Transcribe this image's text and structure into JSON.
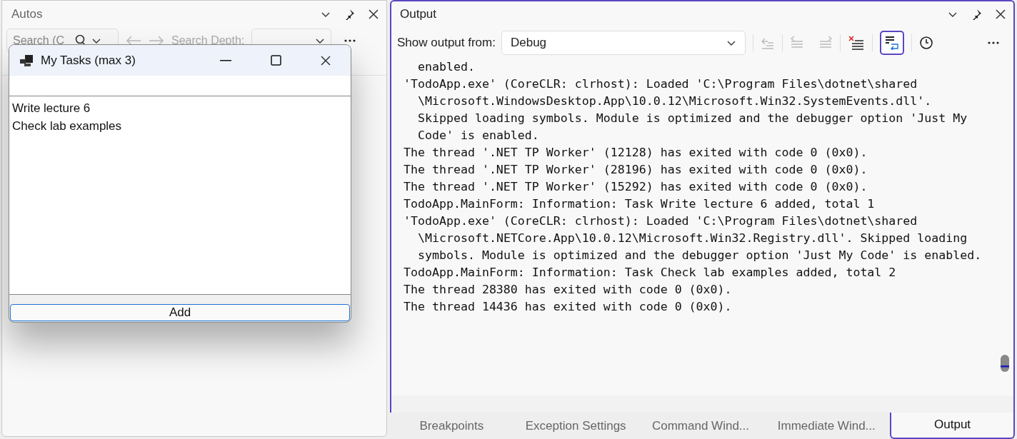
{
  "autos": {
    "title": "Autos",
    "search": {
      "placeholder": "Search (C"
    },
    "depth_label": "Search Depth:"
  },
  "dialog": {
    "title": "My Tasks (max 3)",
    "tasks": [
      "Write lecture 6",
      "Check lab examples"
    ],
    "add_button": "Add"
  },
  "output": {
    "title": "Output",
    "source_label": "Show output from:",
    "source": "Debug",
    "word_wrap": {
      "on": true
    },
    "lines": [
      {
        "text": "enabled.",
        "indent": true
      },
      {
        "text": "'TodoApp.exe' (CoreCLR: clrhost): Loaded 'C:\\Program Files\\dotnet\\shared",
        "indent": false
      },
      {
        "text": "\\Microsoft.WindowsDesktop.App\\10.0.12\\Microsoft.Win32.SystemEvents.dll'.",
        "indent": true
      },
      {
        "text": "Skipped loading symbols. Module is optimized and the debugger option 'Just My",
        "indent": true
      },
      {
        "text": "Code' is enabled.",
        "indent": true
      },
      {
        "text": "The thread '.NET TP Worker' (12128) has exited with code 0 (0x0).",
        "indent": false
      },
      {
        "text": "The thread '.NET TP Worker' (28196) has exited with code 0 (0x0).",
        "indent": false
      },
      {
        "text": "The thread '.NET TP Worker' (15292) has exited with code 0 (0x0).",
        "indent": false
      },
      {
        "text": "TodoApp.MainForm: Information: Task Write lecture 6 added, total 1",
        "indent": false
      },
      {
        "text": "'TodoApp.exe' (CoreCLR: clrhost): Loaded 'C:\\Program Files\\dotnet\\shared",
        "indent": false
      },
      {
        "text": "\\Microsoft.NETCore.App\\10.0.12\\Microsoft.Win32.Registry.dll'. Skipped loading",
        "indent": true
      },
      {
        "text": "symbols. Module is optimized and the debugger option 'Just My Code' is enabled.",
        "indent": true
      },
      {
        "text": "TodoApp.MainForm: Information: Task Check lab examples added, total 2",
        "indent": false
      },
      {
        "text": "The thread 28380 has exited with code 0 (0x0).",
        "indent": false
      },
      {
        "text": "The thread 14436 has exited with code 0 (0x0).",
        "indent": false
      }
    ]
  },
  "tabs": [
    {
      "label": "Breakpoints",
      "selected": false
    },
    {
      "label": "Exception Settings",
      "selected": false
    },
    {
      "label": "Command Wind...",
      "selected": false
    },
    {
      "label": "Immediate Wind...",
      "selected": false
    },
    {
      "label": "Output",
      "selected": true
    }
  ]
}
